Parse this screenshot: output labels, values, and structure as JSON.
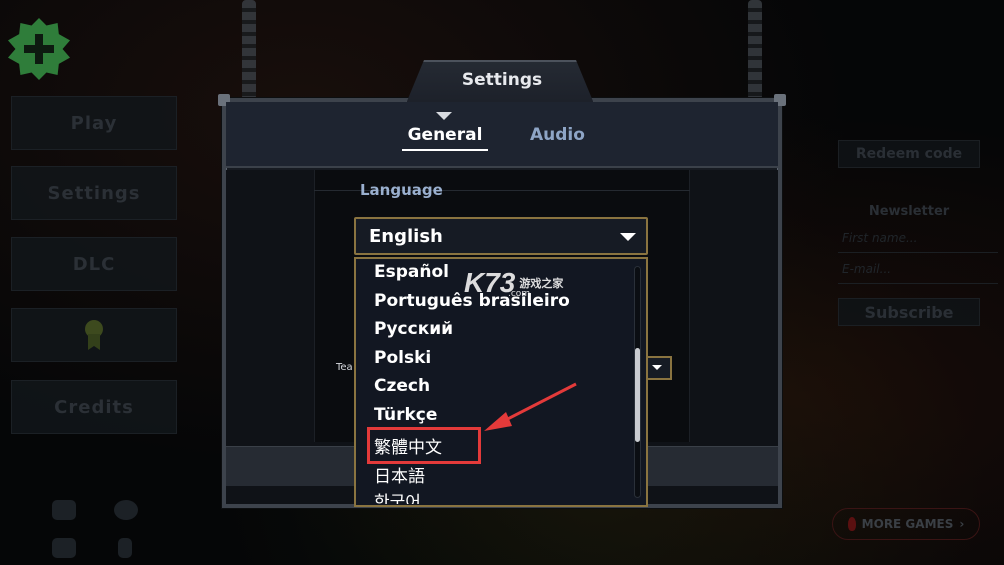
{
  "background_menu": {
    "buttons": [
      "Play",
      "Settings",
      "DLC",
      "Credits"
    ],
    "right_panel": {
      "redeem_label": "Redeem code",
      "newsletter_label": "Newsletter",
      "first_name_placeholder": "First name...",
      "email_placeholder": "E-mail...",
      "subscribe_label": "Subscribe",
      "more_games_label": "MORE GAMES"
    }
  },
  "dialog": {
    "title": "Settings",
    "tabs": [
      {
        "label": "General",
        "active": true
      },
      {
        "label": "Audio",
        "active": false
      }
    ],
    "language_label": "Language",
    "selected_language": "English",
    "hidden_row_label": "Tea",
    "language_options": [
      "Español",
      "Português brasileiro",
      "Русский",
      "Polski",
      "Czech",
      "Türkçe",
      "繁體中文",
      "日本語",
      "한국어"
    ],
    "highlighted_option": "繁體中文"
  },
  "watermark": {
    "logo": "K73",
    "text": "游戏之家",
    "domain": ".com"
  },
  "colors": {
    "dropdown_border": "#8a7440",
    "annotation_red": "#e33a3a",
    "inactive_tab": "#8ea5c6"
  }
}
